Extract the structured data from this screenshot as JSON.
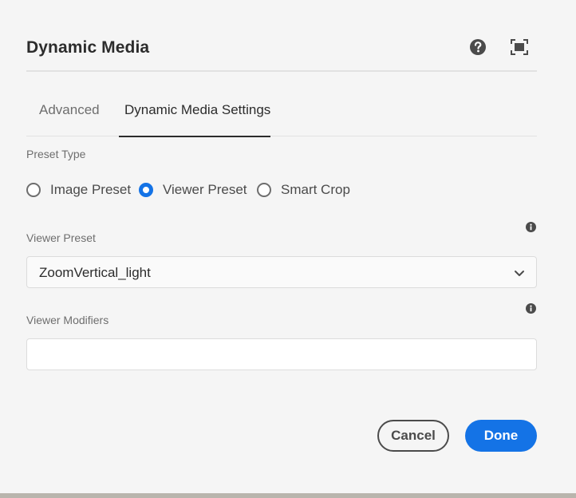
{
  "dialog": {
    "title": "Dynamic Media",
    "help_icon": "help-icon",
    "fullscreen_icon": "fullscreen-icon"
  },
  "tabs": [
    {
      "label": "Advanced",
      "selected": false
    },
    {
      "label": "Dynamic Media Settings",
      "selected": true
    }
  ],
  "preset_type": {
    "label": "Preset Type",
    "options": [
      {
        "label": "Image Preset",
        "checked": false
      },
      {
        "label": "Viewer Preset",
        "checked": true
      },
      {
        "label": "Smart Crop",
        "checked": false
      }
    ]
  },
  "viewer_preset": {
    "label": "Viewer Preset",
    "value": "ZoomVertical_light",
    "info_icon": "info-icon"
  },
  "viewer_modifiers": {
    "label": "Viewer Modifiers",
    "value": "",
    "placeholder": "",
    "info_icon": "info-icon"
  },
  "footer": {
    "cancel_label": "Cancel",
    "done_label": "Done"
  },
  "colors": {
    "accent": "#1473e6",
    "background": "#f5f5f5",
    "text": "#2c2c2c"
  }
}
